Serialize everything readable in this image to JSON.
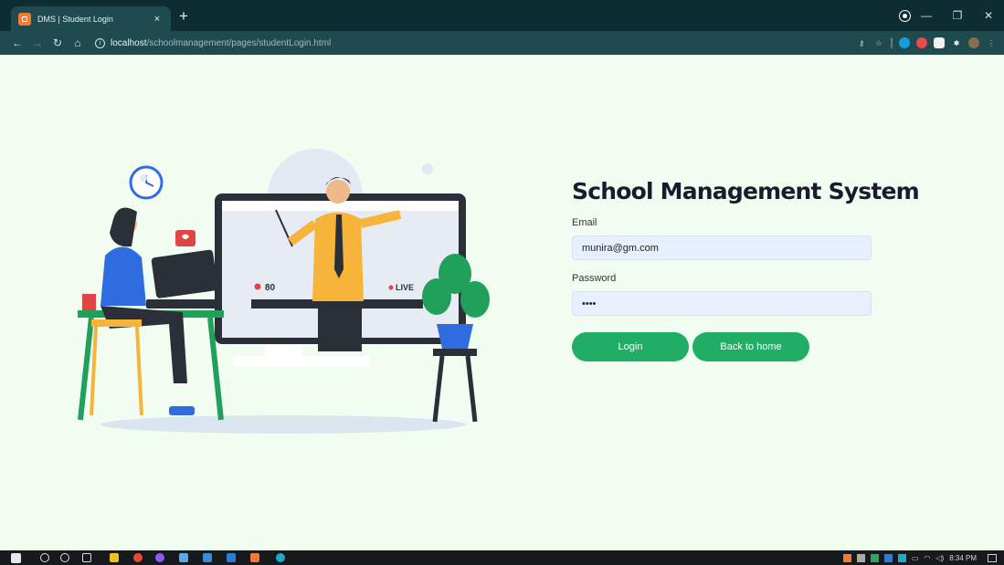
{
  "browser": {
    "tab_title": "DMS | Student Login",
    "tab_close": "×",
    "new_tab": "+",
    "url_host": "localhost",
    "url_path": "/schoolmanagement/pages/studentLogin.html"
  },
  "illustration": {
    "viewer_count": "80",
    "live_badge": "LIVE"
  },
  "login": {
    "title": "School Management System",
    "email_label": "Email",
    "email_value": "munira@gm.com",
    "password_label": "Password",
    "password_value": "1234",
    "login_button": "Login",
    "back_button": "Back to home"
  },
  "taskbar": {
    "clock": "8:34 PM"
  },
  "colors": {
    "page_background": "#f2fdf1",
    "button": "#21ad66",
    "browser_frame": "#0d2d33"
  }
}
